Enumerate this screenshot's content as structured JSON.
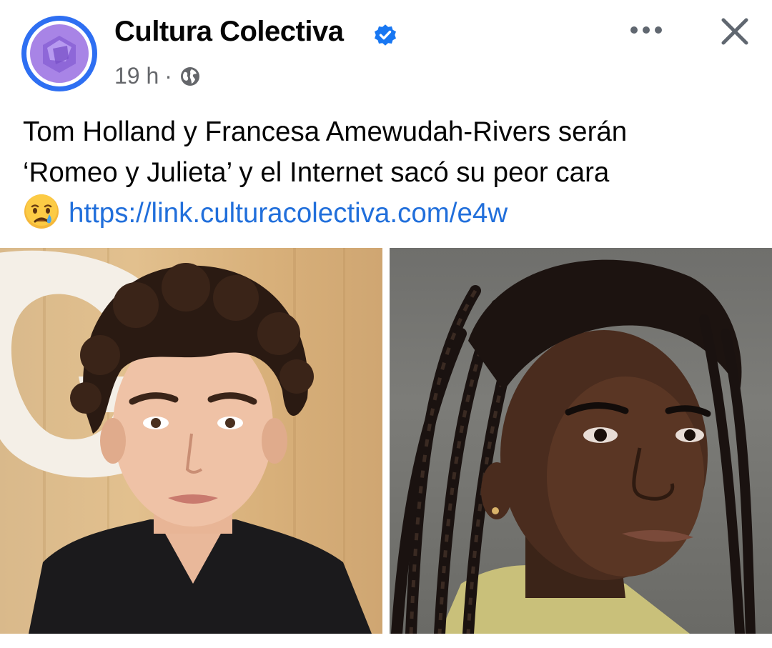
{
  "post": {
    "page_name": "Cultura Colectiva",
    "time": "19 h",
    "separator": "·",
    "text_line1": "Tom Holland y Francesa Amewudah-Rivers serán",
    "text_line2": "‘Romeo y Julieta’ y el Internet sacó su peor cara",
    "link": "https://link.culturacolectiva.com/e4w"
  },
  "icons": {
    "verified": "verified-badge-icon",
    "globe": "globe-icon",
    "more": "more-options-icon",
    "close": "close-icon",
    "emoji": "crying-face-emoji"
  },
  "colors": {
    "link": "#216fdb",
    "verified": "#1877f2",
    "meta": "#65676b",
    "avatar_ring": "#2e6ff2",
    "avatar_fill": "#a884e6"
  }
}
